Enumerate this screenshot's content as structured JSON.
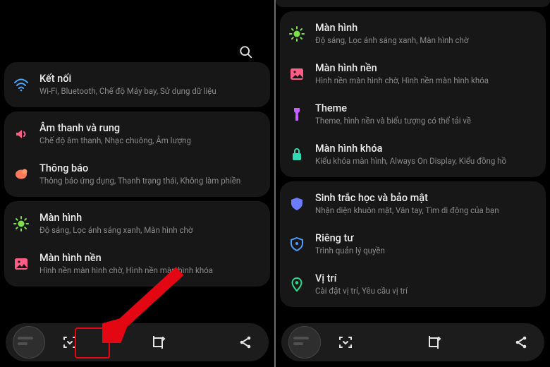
{
  "left": {
    "items": [
      {
        "icon": "wifi",
        "color": "#4aa8ff",
        "title": "Kết nối",
        "sub": "Wi-Fi, Bluetooth, Chế độ Máy bay, Sử dụng dữ liệu"
      },
      {
        "icon": "sound",
        "color": "#ff5d86",
        "title": "Âm thanh và rung",
        "sub": "Chế độ âm thanh, Nhạc chuông, Âm lượng"
      },
      {
        "icon": "notif",
        "color": "#ff7a5c",
        "title": "Thông báo",
        "sub": "Thông báo ứng dụng, Thanh trạng thái, Không làm phiền"
      },
      {
        "icon": "display",
        "color": "#7fe04e",
        "title": "Màn hình",
        "sub": "Độ sáng, Lọc ánh sáng xanh, Màn hình chờ"
      },
      {
        "icon": "wallpaper",
        "color": "#ff5d86",
        "title": "Màn hình nền",
        "sub": "Hình nền màn hình chờ, Hình nền màn hình khóa"
      }
    ],
    "faded": "Theme, hình nền và biểu tượng có thể tải về"
  },
  "right": {
    "items_group1": [
      {
        "icon": "display",
        "color": "#7fe04e",
        "title": "Màn hình",
        "sub": "Độ sáng, Lọc ánh sáng xanh, Màn hình chờ"
      },
      {
        "icon": "wallpaper",
        "color": "#ff5d86",
        "title": "Màn hình nền",
        "sub": "Hình nền màn hình chờ, Hình nền màn hình khóa"
      },
      {
        "icon": "theme",
        "color": "#c75eff",
        "title": "Theme",
        "sub": "Theme, hình nền và biểu tượng có thể tải về"
      },
      {
        "icon": "lock",
        "color": "#2ed9b4",
        "title": "Màn hình khóa",
        "sub": "Kiểu khóa màn hình, Always On Display, Kiểu đồng hồ"
      }
    ],
    "items_group2": [
      {
        "icon": "shield",
        "color": "#6b7cff",
        "title": "Sinh trắc học và bảo mật",
        "sub": "Nhận diện khuôn mặt, Vân tay, Tìm di động của bạn"
      },
      {
        "icon": "privacy",
        "color": "#4a9eff",
        "title": "Riêng tư",
        "sub": "Trình quản lý quyền"
      },
      {
        "icon": "location",
        "color": "#2ed98f",
        "title": "Vị trí",
        "sub": "Cài đặt vị trí, Yêu cầu vị trí"
      }
    ]
  }
}
